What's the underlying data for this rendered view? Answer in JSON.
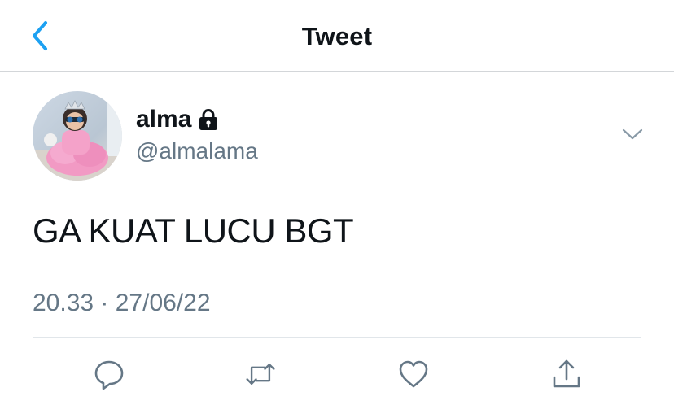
{
  "header": {
    "title": "Tweet",
    "back_icon": "chevron-left-icon",
    "accent_color": "#1da1f2"
  },
  "tweet": {
    "author": {
      "name": "alma",
      "handle": "@almalama",
      "protected_icon": "lock-icon"
    },
    "menu_icon": "chevron-down-icon",
    "text": "GA KUAT LUCU BGT",
    "timestamp": "20.33 · 27/06/22",
    "actions": [
      {
        "name": "reply",
        "icon": "comment-icon"
      },
      {
        "name": "retweet",
        "icon": "retweet-icon"
      },
      {
        "name": "like",
        "icon": "heart-icon"
      },
      {
        "name": "share",
        "icon": "share-icon"
      }
    ]
  },
  "colors": {
    "text": "#0f1419",
    "secondary": "#657786",
    "divider": "#e1e6ea",
    "icon": "#657786"
  }
}
